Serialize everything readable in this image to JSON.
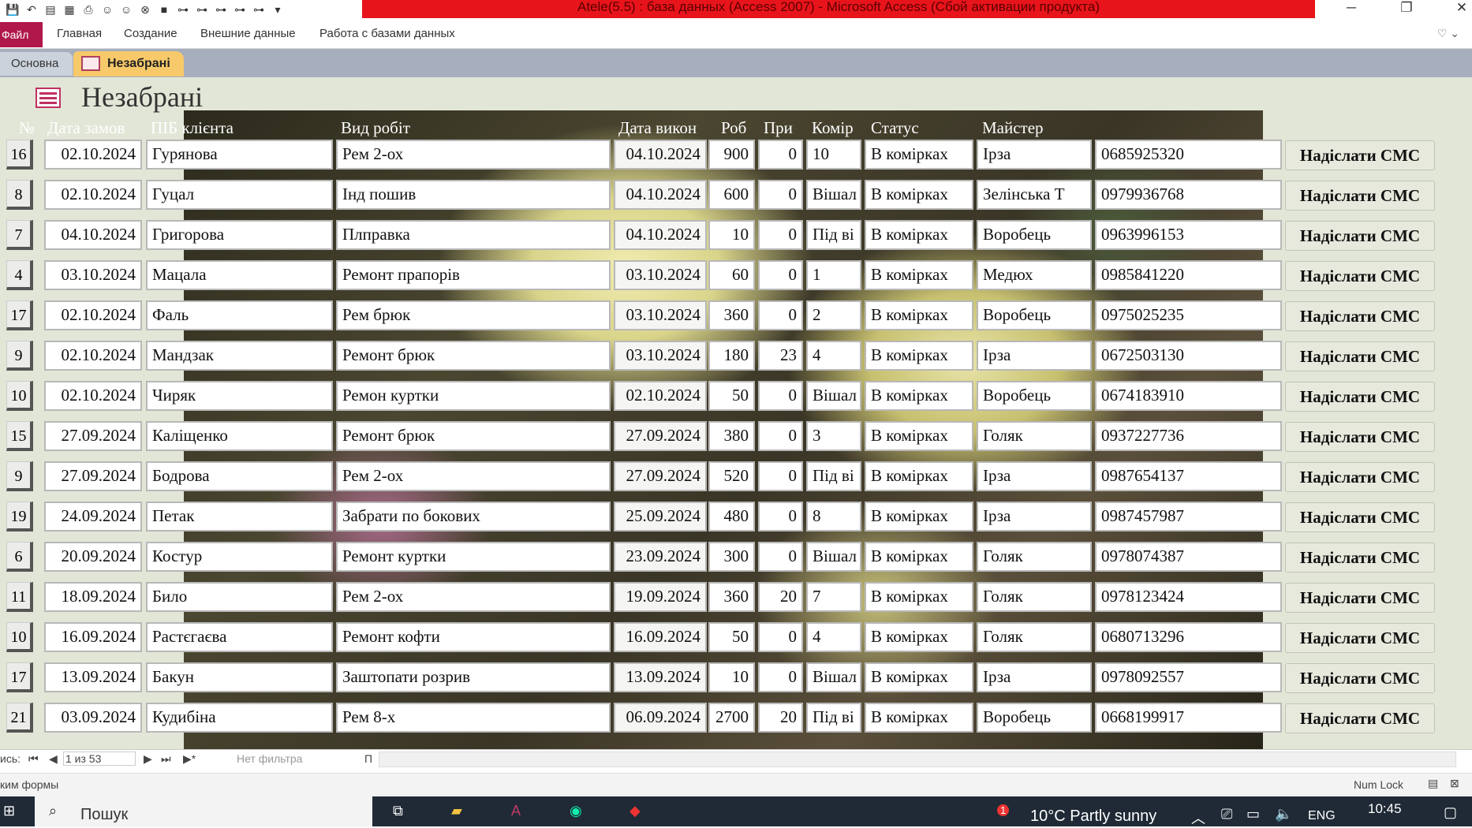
{
  "window": {
    "title": "Atele(5.5) : база данных (Access 2007)  - Microsoft Access (Сбой активации продукта)"
  },
  "ribbon": {
    "file": "Файл",
    "tabs": [
      "Главная",
      "Создание",
      "Внешние данные",
      "Работа с базами данных"
    ]
  },
  "doc_tabs": [
    "Основна",
    "Незабрані"
  ],
  "form": {
    "title": "Незабрані"
  },
  "columns": [
    "№",
    "Дата замов",
    "ПІБ клієнта",
    "Вид робіт",
    "Дата викон",
    "Роб",
    "При",
    "Комір",
    "Статус",
    "Майстер"
  ],
  "sms_label": "Надіслати СМС",
  "rows": [
    {
      "n": "16",
      "d1": "02.10.2024",
      "name": "Гурянова",
      "work": "Рем 2-ох",
      "d2": "04.10.2024",
      "rob": "900",
      "pri": "0",
      "kom": "10",
      "status": "В комірках",
      "master": "Ірза",
      "phone": "0685925320"
    },
    {
      "n": "8",
      "d1": "02.10.2024",
      "name": "Гуцал",
      "work": "Інд пошив",
      "d2": "04.10.2024",
      "rob": "600",
      "pri": "0",
      "kom": "Вішал",
      "status": "В комірках",
      "master": "Зелінська Т",
      "phone": "0979936768"
    },
    {
      "n": "7",
      "d1": "04.10.2024",
      "name": "Григорова",
      "work": "Плправка",
      "d2": "04.10.2024",
      "rob": "10",
      "pri": "0",
      "kom": "Під ві",
      "status": "В комірках",
      "master": "Воробець",
      "phone": "0963996153"
    },
    {
      "n": "4",
      "d1": "03.10.2024",
      "name": "Мацала",
      "work": "Ремонт прапорів",
      "d2": "03.10.2024",
      "rob": "60",
      "pri": "0",
      "kom": "1",
      "status": "В комірках",
      "master": "Медюх",
      "phone": "0985841220"
    },
    {
      "n": "17",
      "d1": "02.10.2024",
      "name": "Фаль",
      "work": "Рем брюк",
      "d2": "03.10.2024",
      "rob": "360",
      "pri": "0",
      "kom": "2",
      "status": "В комірках",
      "master": "Воробець",
      "phone": "0975025235"
    },
    {
      "n": "9",
      "d1": "02.10.2024",
      "name": "Мандзак",
      "work": "Ремонт брюк",
      "d2": "03.10.2024",
      "rob": "180",
      "pri": "23",
      "kom": "4",
      "status": "В комірках",
      "master": "Ірза",
      "phone": "0672503130"
    },
    {
      "n": "10",
      "d1": "02.10.2024",
      "name": "Чиряк",
      "work": "Ремон куртки",
      "d2": "02.10.2024",
      "rob": "50",
      "pri": "0",
      "kom": "Вішал",
      "status": "В комірках",
      "master": "Воробець",
      "phone": "0674183910"
    },
    {
      "n": "15",
      "d1": "27.09.2024",
      "name": "Каліщенко",
      "work": "Ремонт брюк",
      "d2": "27.09.2024",
      "rob": "380",
      "pri": "0",
      "kom": "3",
      "status": "В комірках",
      "master": "Голяк",
      "phone": "0937227736"
    },
    {
      "n": "9",
      "d1": "27.09.2024",
      "name": "Бодрова",
      "work": "Рем 2-ох",
      "d2": "27.09.2024",
      "rob": "520",
      "pri": "0",
      "kom": "Під ві",
      "status": "В комірках",
      "master": "Ірза",
      "phone": "0987654137"
    },
    {
      "n": "19",
      "d1": "24.09.2024",
      "name": "Петак",
      "work": "Забрати по бокових",
      "d2": "25.09.2024",
      "rob": "480",
      "pri": "0",
      "kom": "8",
      "status": "В комірках",
      "master": "Ірза",
      "phone": "0987457987"
    },
    {
      "n": "6",
      "d1": "20.09.2024",
      "name": "Костур",
      "work": "Ремонт куртки",
      "d2": "23.09.2024",
      "rob": "300",
      "pri": "0",
      "kom": "Вішал",
      "status": "В комірках",
      "master": "Голяк",
      "phone": "0978074387"
    },
    {
      "n": "11",
      "d1": "18.09.2024",
      "name": "Било",
      "work": "Рем 2-ох",
      "d2": "19.09.2024",
      "rob": "360",
      "pri": "20",
      "kom": "7",
      "status": "В комірках",
      "master": "Голяк",
      "phone": "0978123424"
    },
    {
      "n": "10",
      "d1": "16.09.2024",
      "name": "Растєгаєва",
      "work": "Ремонт кофти",
      "d2": "16.09.2024",
      "rob": "50",
      "pri": "0",
      "kom": "4",
      "status": "В комірках",
      "master": "Голяк",
      "phone": "0680713296"
    },
    {
      "n": "17",
      "d1": "13.09.2024",
      "name": "Бакун",
      "work": "Заштопати розрив",
      "d2": "13.09.2024",
      "rob": "10",
      "pri": "0",
      "kom": "Вішал",
      "status": "В комірках",
      "master": "Ірза",
      "phone": "0978092557"
    },
    {
      "n": "21",
      "d1": "03.09.2024",
      "name": "Кудибіна",
      "work": "Рем 8-х",
      "d2": "06.09.2024",
      "rob": "2700",
      "pri": "20",
      "kom": "Під ві",
      "status": "В комірках",
      "master": "Воробець",
      "phone": "0668199917"
    }
  ],
  "navigation": {
    "record_label": "ись:",
    "record_position": "1 из 53",
    "filter": "Нет фильтра",
    "search_partial": "П"
  },
  "status": {
    "mode": "ким формы",
    "numlock": "Num Lock"
  },
  "taskbar": {
    "search": "Пошук",
    "weather": "10°C  Partly sunny",
    "lang": "ENG",
    "time": "10:45",
    "notif": "1"
  }
}
